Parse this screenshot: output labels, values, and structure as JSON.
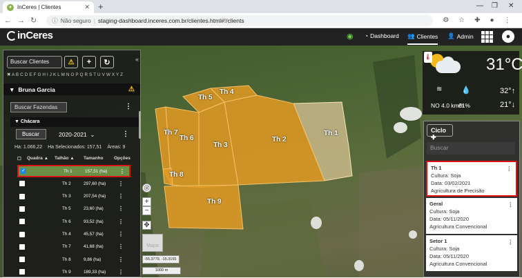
{
  "browser": {
    "tab_title": "InCeres | Clientes",
    "new_tab": "+",
    "secure_label": "Não seguro",
    "url": "staging-dashboard.inceres.com.br/clientes.html#!/clients"
  },
  "topnav": {
    "logo": "inCeres",
    "items": [
      {
        "label": "Dashboard",
        "icon": "dashboard-icon"
      },
      {
        "label": "Clientes",
        "icon": "clients-icon"
      },
      {
        "label": "Admin",
        "icon": "admin-icon"
      }
    ]
  },
  "sidebar": {
    "search_placeholder": "Buscar Clientes",
    "alphabet": "✖ A B C D E F G H I J K L M N O P Q R S T U V W X Y Z",
    "owner": "Bruna Garcia",
    "farm_search": "Buscar Fazendas",
    "farm_name": "Chácara",
    "search_button": "Buscar",
    "season": "2020-2021",
    "stats": {
      "area": "Ha: 1.066,22",
      "selected": "Ha Selecionados: 157,51",
      "count": "Áreas: 9"
    },
    "columns": [
      "Quadra",
      "Talhão",
      "Tamanho",
      "Opções"
    ],
    "rows": [
      {
        "name": "Th 1",
        "size": "157,51 (ha)",
        "checked": true
      },
      {
        "name": "Th 2",
        "size": "297,60 (ha)",
        "checked": false
      },
      {
        "name": "Th 3",
        "size": "207,54 (ha)",
        "checked": false
      },
      {
        "name": "Th 5",
        "size": "23,60 (ha)",
        "checked": false
      },
      {
        "name": "Th 6",
        "size": "93,52 (ha)",
        "checked": false
      },
      {
        "name": "Th 4",
        "size": "45,57 (ha)",
        "checked": false
      },
      {
        "name": "Th 7",
        "size": "41,68 (ha)",
        "checked": false
      },
      {
        "name": "Th 8",
        "size": "9,86 (ha)",
        "checked": false
      },
      {
        "name": "Th 9",
        "size": "189,33 (ha)",
        "checked": false
      }
    ]
  },
  "map": {
    "plots": [
      "Th 1",
      "Th 2",
      "Th 3",
      "Th 4",
      "Th 5",
      "Th 6",
      "Th 7",
      "Th 8",
      "Th 9"
    ],
    "coords": "-55.3779, -15.3165",
    "scale": "1000 m",
    "basemap_label": "Mapa",
    "colors": {
      "plot_fill": "#e39a23",
      "selected_fill": "#c9b88a"
    }
  },
  "weather": {
    "temp": "31°C",
    "wind": "NO 4.0 km/h",
    "humidity": "61%",
    "max": "32°",
    "min": "21°"
  },
  "cycle": {
    "button": "Ciclo",
    "search_placeholder": "Buscar",
    "cards": [
      {
        "title": "Th 1",
        "culture": "Cultura: Soja",
        "date": "Data: 03/02/2021",
        "type": "Agricultura de Precisão"
      },
      {
        "title": "Geral",
        "culture": "Cultura: Soja",
        "date": "Data: 05/11/2020",
        "type": "Agricultura Convencional"
      },
      {
        "title": "Setor 1",
        "culture": "Cultura: Soja",
        "date": "Data: 05/11/2020",
        "type": "Agricultura Convencional"
      }
    ]
  }
}
